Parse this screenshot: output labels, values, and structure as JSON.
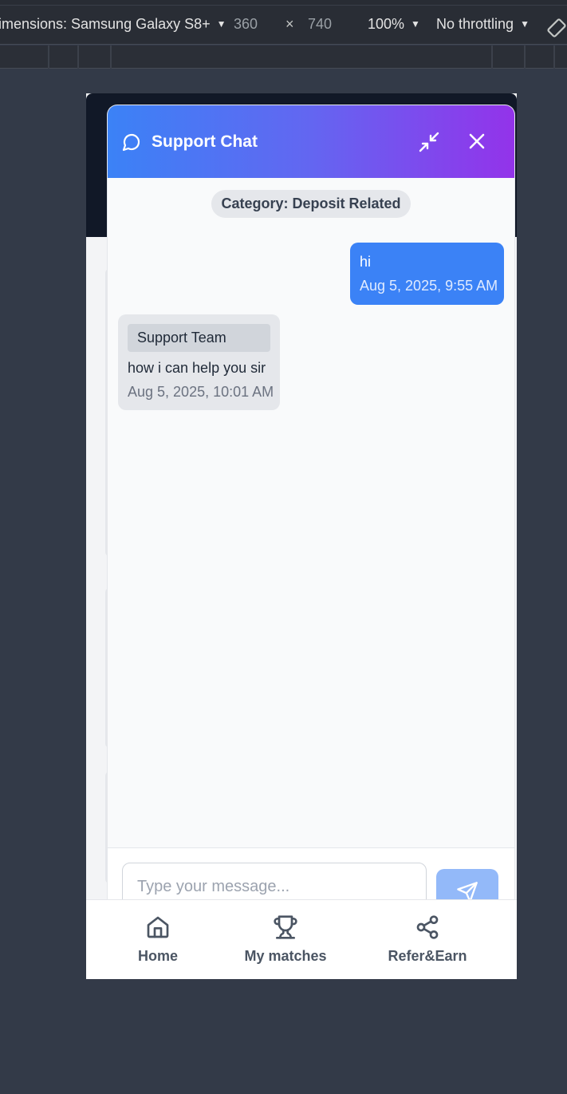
{
  "devtools": {
    "dimensions_label": "imensions: Samsung Galaxy S8+",
    "width": "360",
    "times": "×",
    "height": "740",
    "zoom": "100%",
    "throttling": "No throttling",
    "caret": "▼"
  },
  "chat": {
    "title": "Support Chat",
    "category": "Category: Deposit Related",
    "messages": [
      {
        "sender": "user",
        "text": "hi",
        "time": "Aug 5, 2025, 9:55 AM"
      },
      {
        "sender": "Support Team",
        "text": "how i can help you sir",
        "time": "Aug 5, 2025, 10:01 AM"
      }
    ],
    "input_placeholder": "Type your message..."
  },
  "nav": {
    "items": [
      {
        "label": "Home",
        "icon": "home-icon"
      },
      {
        "label": "My matches",
        "icon": "trophy-icon"
      },
      {
        "label": "Refer&Earn",
        "icon": "share-icon"
      }
    ]
  },
  "colors": {
    "header_gradient_start": "#3b82f6",
    "header_gradient_end": "#9333ea",
    "user_bubble": "#3b82f6",
    "support_bubble": "#e5e7eb"
  }
}
